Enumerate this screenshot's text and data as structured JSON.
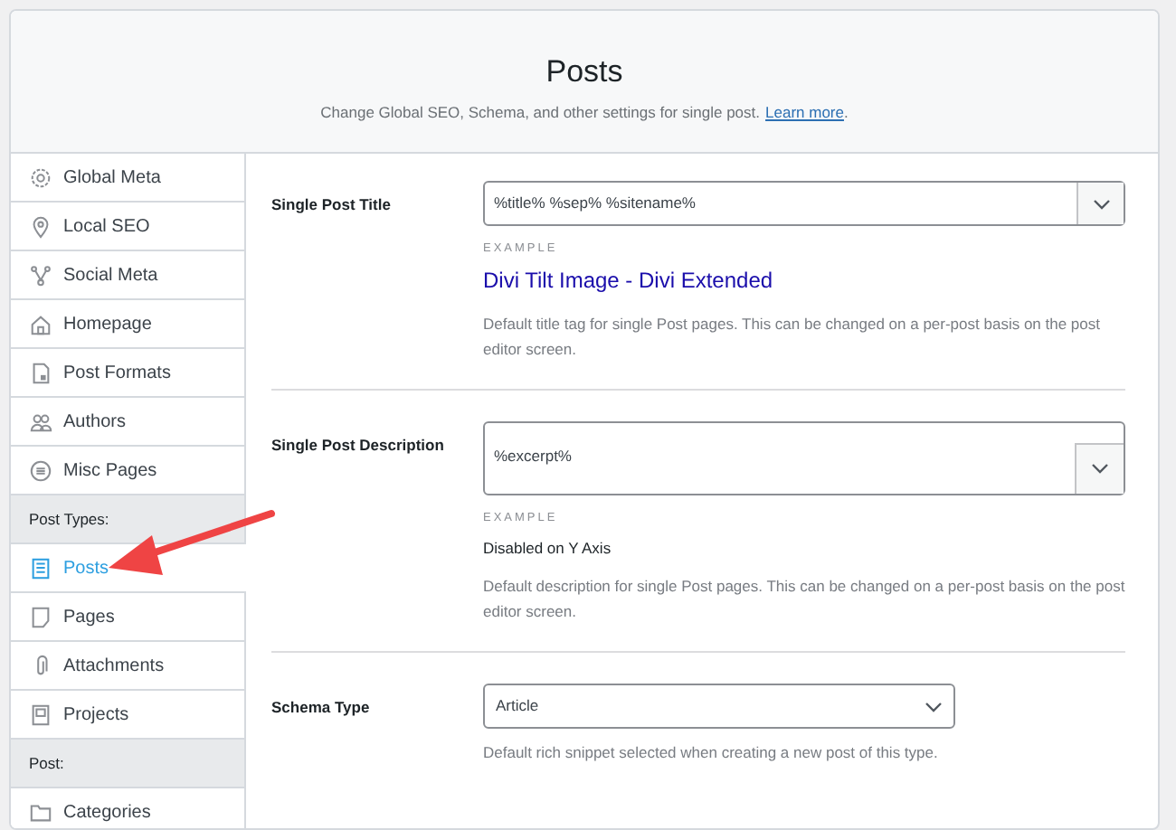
{
  "header": {
    "title": "Posts",
    "subtitle": "Change Global SEO, Schema, and other settings for single post.",
    "link": "Learn more",
    "after_link": "."
  },
  "sidebar": {
    "items": [
      {
        "kind": "item",
        "label": "Global Meta",
        "selected": false
      },
      {
        "kind": "item",
        "label": "Local SEO",
        "selected": false
      },
      {
        "kind": "item",
        "label": "Social Meta",
        "selected": false
      },
      {
        "kind": "item",
        "label": "Homepage",
        "selected": false
      },
      {
        "kind": "item",
        "label": "Post Formats",
        "selected": false
      },
      {
        "kind": "item",
        "label": "Authors",
        "selected": false
      },
      {
        "kind": "item",
        "label": "Misc Pages",
        "selected": false
      },
      {
        "kind": "heading",
        "label": "Post Types:"
      },
      {
        "kind": "item",
        "label": "Posts",
        "selected": true
      },
      {
        "kind": "item",
        "label": "Pages",
        "selected": false
      },
      {
        "kind": "item",
        "label": "Attachments",
        "selected": false
      },
      {
        "kind": "item",
        "label": "Projects",
        "selected": false
      },
      {
        "kind": "heading",
        "label": "Post:"
      },
      {
        "kind": "item",
        "label": "Categories",
        "selected": false
      }
    ]
  },
  "settings": [
    {
      "kind": "input",
      "label": "Single Post Title",
      "value": "%title% %sep% %sitename%",
      "example_label": "EXAMPLE",
      "example": "Divi Tilt Image - Divi Extended",
      "example_is_link": true,
      "help": "Default title tag for single Post pages. This can be changed on a per-post basis on the post editor screen."
    },
    {
      "kind": "textarea",
      "label": "Single Post Description",
      "value": "%excerpt%",
      "example_label": "EXAMPLE",
      "example": "Disabled on Y Axis",
      "example_is_link": false,
      "help": "Default description for single Post pages. This can be changed on a per-post basis on the post editor screen."
    },
    {
      "kind": "select",
      "label": "Schema Type",
      "value": "Article",
      "help": "Default rich snippet selected when creating a new post of this type."
    }
  ]
}
